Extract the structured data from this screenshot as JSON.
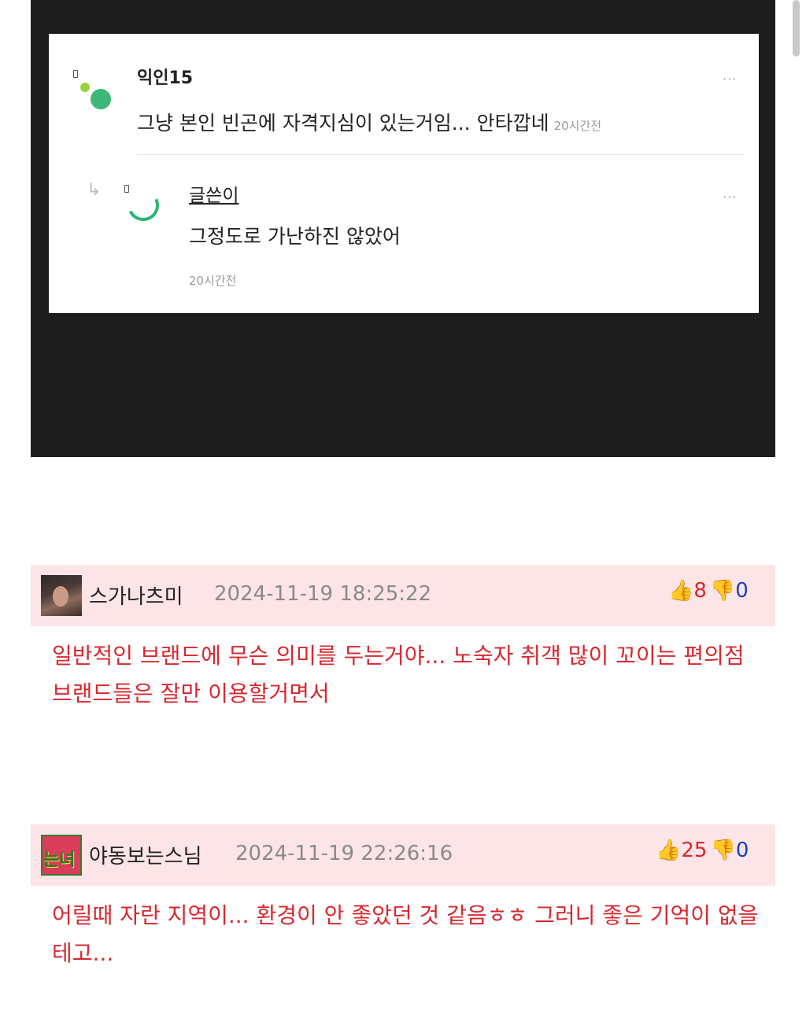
{
  "embed": {
    "comment": {
      "author": "익인15",
      "text": "그냥 본인 빈곤에 자격지심이 있는거임... 안타깝네",
      "time": "20시간전",
      "menu": "···"
    },
    "reply": {
      "arrow": "↳",
      "author": "글쓴이",
      "text": "그정도로 가난하진 않았어",
      "time": "20시간전",
      "menu": "···"
    }
  },
  "comments": [
    {
      "username": "스가나츠미",
      "date": "2024-11-19 18:25:22",
      "likes": "8",
      "dislikes": "0",
      "body": "일반적인 브랜드에 무슨 의미를 두는거야... 노숙자 취객 많이 꼬이는 편의점 브랜드들은 잘만 이용할거면서",
      "avatar_icon": "photo-avatar"
    },
    {
      "username": "야동보는스님",
      "date": "2024-11-19 22:26:16",
      "likes": "25",
      "dislikes": "0",
      "body": "어릴때 자란 지역이... 환경이 안 좋았던 것 같음ㅎㅎ 그러니 좋은 기억이 없을테고...",
      "avatar_icon": "text-avatar",
      "avatar_text": "는녀"
    }
  ],
  "icons": {
    "thumbs_up": "👍",
    "thumbs_down": "👎"
  },
  "colors": {
    "accent_red": "#d9272e",
    "dislike_blue": "#1b3fbd",
    "comment_header_bg": "#fde4e6",
    "avatar_green": "#3cb878"
  }
}
